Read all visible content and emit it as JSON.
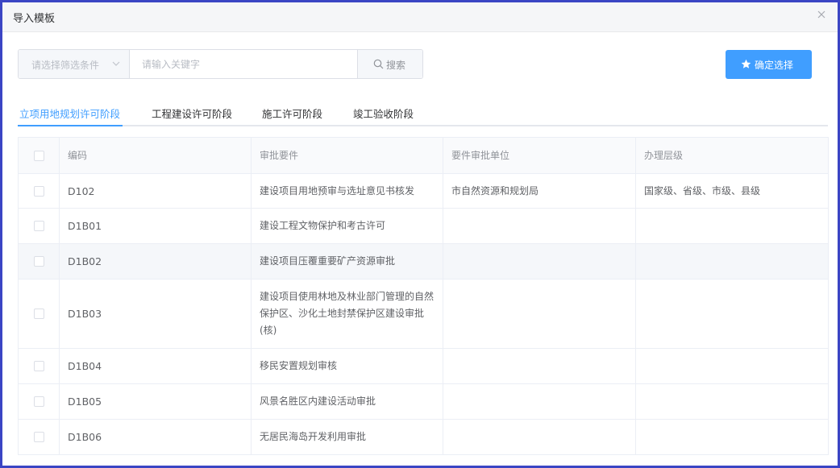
{
  "dialog": {
    "title": "导入模板"
  },
  "search": {
    "filter_placeholder": "请选择筛选条件",
    "keyword_placeholder": "请输入关键字",
    "button_label": "搜索"
  },
  "confirm": {
    "label": "确定选择"
  },
  "tabs": [
    {
      "label": "立项用地规划许可阶段",
      "active": true
    },
    {
      "label": "工程建设许可阶段",
      "active": false
    },
    {
      "label": "施工许可阶段",
      "active": false
    },
    {
      "label": "竣工验收阶段",
      "active": false
    }
  ],
  "table": {
    "columns": [
      "编码",
      "审批要件",
      "要件审批单位",
      "办理层级"
    ],
    "rows": [
      {
        "code": "D102",
        "name": "建设项目用地预审与选址意见书核发",
        "unit": "市自然资源和规划局",
        "level": "国家级、省级、市级、县级"
      },
      {
        "code": "D1B01",
        "name": "建设工程文物保护和考古许可",
        "unit": "",
        "level": ""
      },
      {
        "code": "D1B02",
        "name": "建设项目压覆重要矿产资源审批",
        "unit": "",
        "level": ""
      },
      {
        "code": "D1B03",
        "name": "建设项目使用林地及林业部门管理的自然保护区、沙化土地封禁保护区建设审批(核)",
        "unit": "",
        "level": ""
      },
      {
        "code": "D1B04",
        "name": "移民安置规划审核",
        "unit": "",
        "level": ""
      },
      {
        "code": "D1B05",
        "name": "风景名胜区内建设活动审批",
        "unit": "",
        "level": ""
      },
      {
        "code": "D1B06",
        "name": "无居民海岛开发利用审批",
        "unit": "",
        "level": ""
      }
    ]
  },
  "colors": {
    "accent": "#409eff",
    "frame": "#3b45c4",
    "highlight_row": "#f5f7fa"
  },
  "icons": {
    "close": "close-icon",
    "chevron": "chevron-down-icon",
    "search": "search-icon",
    "star": "star-icon"
  }
}
